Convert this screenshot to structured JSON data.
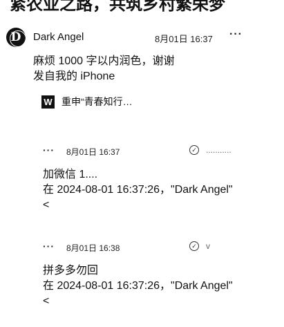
{
  "heading": "紧农业之路，共筑乡村繁荣梦",
  "post": {
    "avatar_letter": "D",
    "username": "Dark Angel",
    "time": "8月01日 16:37",
    "more_icon": "more-horizontal-icon",
    "body_line1": "麻烦 1000 字以内润色，谢谢",
    "body_line2": "发自我的 iPhone",
    "attachment": {
      "icon_letter": "W",
      "title": "重申“青春知行…"
    }
  },
  "replies": [
    {
      "time": "8月01日 16:37",
      "handle": "...........",
      "line1": "加微信 1....",
      "line2": "在 2024-08-01 16:37:26，\"Dark Angel\"",
      "line3": "<"
    },
    {
      "time": "8月01日 16:38",
      "handle": "v",
      "line1": "拼多多勿回",
      "line2": "在 2024-08-01 16:37:26，\"Dark Angel\"",
      "line3": "<"
    }
  ]
}
